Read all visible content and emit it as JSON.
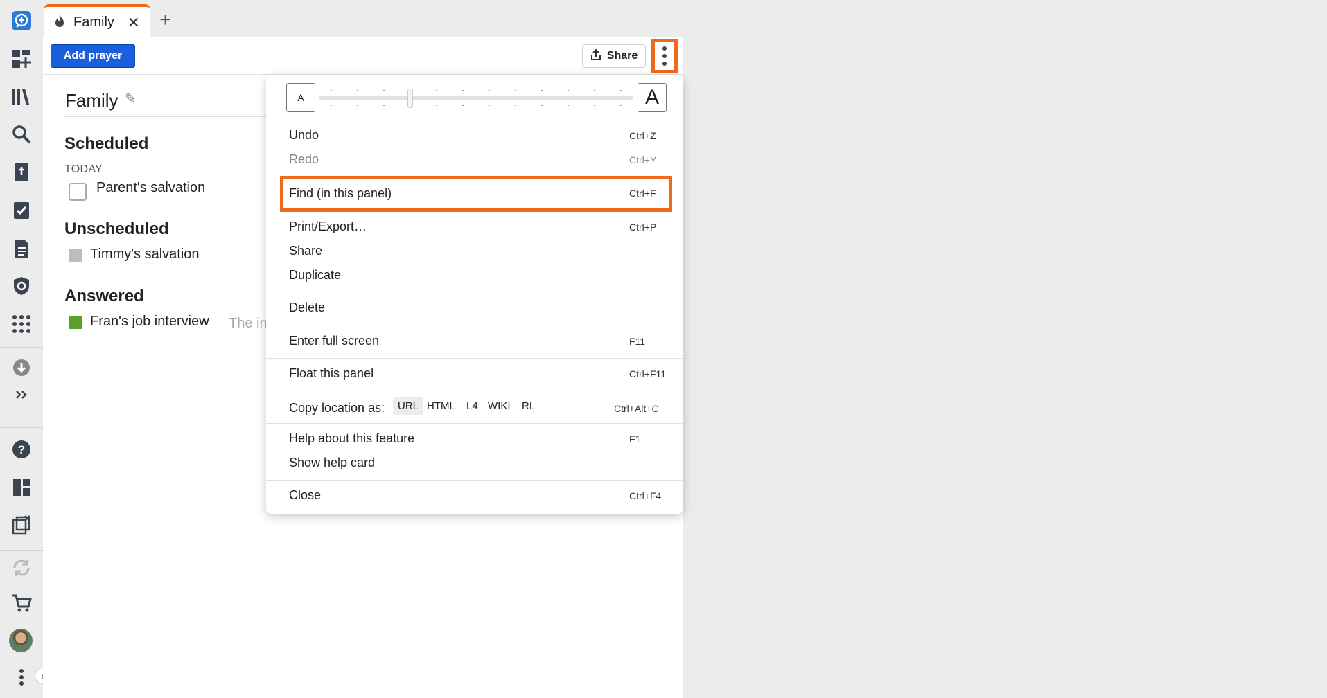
{
  "tab": {
    "label": "Family",
    "close": "✕",
    "add": "+"
  },
  "toolbar": {
    "add_prayer": "Add prayer",
    "share": "Share"
  },
  "list": {
    "title": "Family",
    "scheduled": {
      "heading": "Scheduled",
      "group": "TODAY",
      "items": [
        {
          "label": "Parent's salvation"
        }
      ]
    },
    "unscheduled": {
      "heading": "Unscheduled",
      "items": [
        {
          "label": "Timmy's salvation",
          "color": "#bdbdbd"
        }
      ]
    },
    "answered": {
      "heading": "Answered",
      "items": [
        {
          "label": "Fran's job interview",
          "note": "The in",
          "color": "#5aa12b"
        }
      ]
    }
  },
  "menu": {
    "font_small": "A",
    "font_large": "A",
    "font_level": 0.28,
    "undo": {
      "label": "Undo",
      "shortcut": "Ctrl+Z"
    },
    "redo": {
      "label": "Redo",
      "shortcut": "Ctrl+Y"
    },
    "find": {
      "label": "Find (in this panel)",
      "shortcut": "Ctrl+F"
    },
    "print": {
      "label": "Print/Export…",
      "shortcut": "Ctrl+P"
    },
    "share": {
      "label": "Share"
    },
    "duplicate": {
      "label": "Duplicate"
    },
    "delete": {
      "label": "Delete"
    },
    "fullscreen": {
      "label": "Enter full screen",
      "shortcut": "F11"
    },
    "float": {
      "label": "Float this panel",
      "shortcut": "Ctrl+F11"
    },
    "copy_location": {
      "label": "Copy location as:",
      "formats": [
        "URL",
        "HTML",
        "L4",
        "WIKI",
        "RL"
      ],
      "shortcut": "Ctrl+Alt+C"
    },
    "help": {
      "label": "Help about this feature",
      "shortcut": "F1"
    },
    "help_card": {
      "label": "Show help card"
    },
    "close": {
      "label": "Close",
      "shortcut": "Ctrl+F4"
    }
  },
  "colors": {
    "accent": "#f06a1d",
    "primary": "#1a5fdc"
  }
}
